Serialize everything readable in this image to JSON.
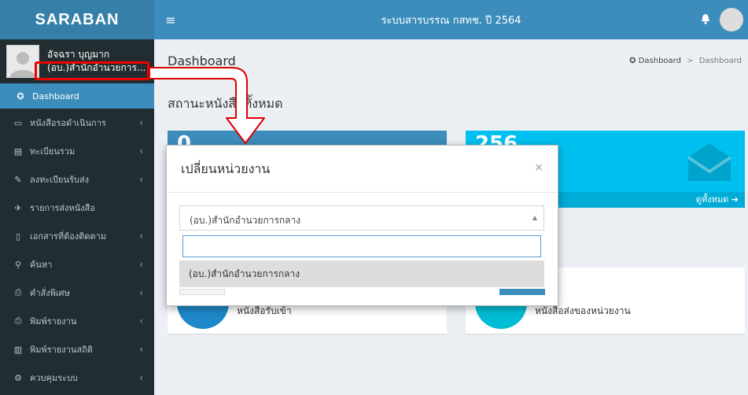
{
  "app": {
    "logo": "SARABAN",
    "title": "ระบบสารบรรณ กสทช. ปี 2564"
  },
  "user": {
    "name": "อัจฉรา บุญมาก",
    "unit": "(อบ.)สำนักอำนวยการ..."
  },
  "sidebar": {
    "items": [
      {
        "label": "Dashboard",
        "icon": "dashboard-icon",
        "glyph": "✪"
      },
      {
        "label": "หนังสือรอดำเนินการ",
        "icon": "inbox-icon",
        "glyph": "▭",
        "chev": "‹"
      },
      {
        "label": "ทะเบียนรวม",
        "icon": "book-icon",
        "glyph": "▤",
        "chev": "‹"
      },
      {
        "label": "ลงทะเบียนรับส่ง",
        "icon": "edit-icon",
        "glyph": "✎",
        "chev": "‹"
      },
      {
        "label": "รายการส่งหนังสือ",
        "icon": "send-icon",
        "glyph": "✈"
      },
      {
        "label": "เอกสารที่ต้องติดตาม",
        "icon": "bookmark-icon",
        "glyph": "▯",
        "chev": "‹"
      },
      {
        "label": "ค้นหา",
        "icon": "search-icon",
        "glyph": "⚲",
        "chev": "‹"
      },
      {
        "label": "คำสั่งพิเศษ",
        "icon": "print-icon",
        "glyph": "⎙",
        "chev": "‹"
      },
      {
        "label": "พิมพ์รายงาน",
        "icon": "print-icon",
        "glyph": "⎙",
        "chev": "‹"
      },
      {
        "label": "พิมพ์รายงานสถิติ",
        "icon": "chart-icon",
        "glyph": "▥",
        "chev": "‹"
      },
      {
        "label": "ควบคุมระบบ",
        "icon": "gear-icon",
        "glyph": "⚙",
        "chev": "‹"
      }
    ]
  },
  "header": {
    "menu_glyph": "≡"
  },
  "page": {
    "title": "Dashboard",
    "breadcrumb": {
      "home": "Dashboard",
      "sep": ">",
      "current": "Dashboard"
    },
    "section_title": "สถานะหนังสือทั้งหมด"
  },
  "stats": [
    {
      "number": "0",
      "color": "#3c8dbc"
    },
    {
      "number": "256",
      "color": "#00c0ef",
      "footer": "ดูทั้งหมด ➔"
    }
  ],
  "info": [
    {
      "label": "หนังสือรับเข้า",
      "color": "#1e88c8"
    },
    {
      "label": "หนังสือส่งของหน่วยงาน",
      "color": "#00bcd4"
    }
  ],
  "modal": {
    "title": "เปลี่ยนหน่วยงาน",
    "close": "×",
    "selected": "(อบ.)สำนักอำนวยการกลาง",
    "search_value": "",
    "options": [
      "(อบ.)สำนักอำนวยการกลาง"
    ]
  },
  "colors": {
    "primary": "#3c8dbc",
    "sidebar": "#222d32",
    "highlight": "#e00000"
  }
}
